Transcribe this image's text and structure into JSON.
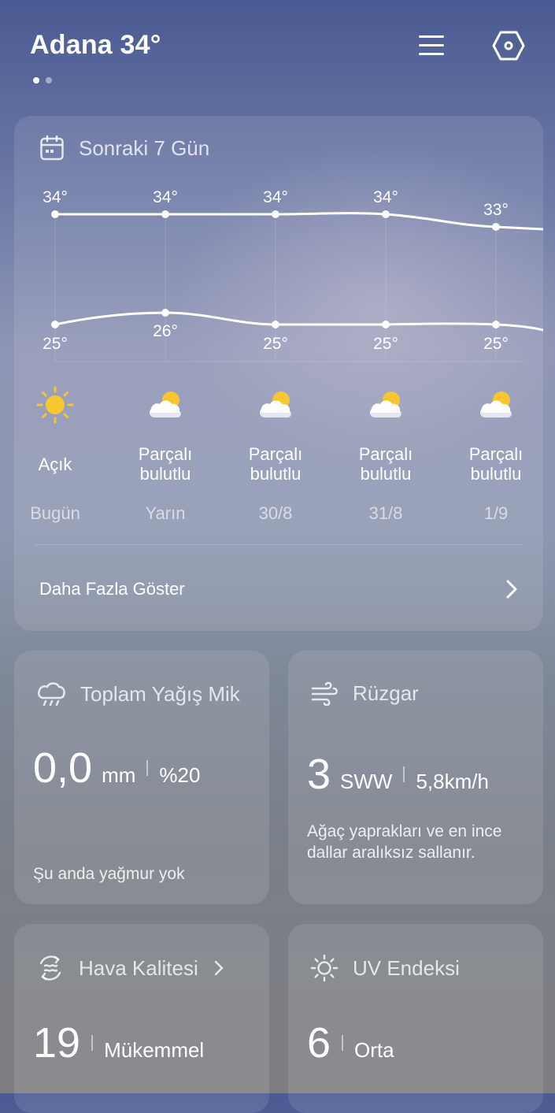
{
  "header": {
    "title": "Adana 34°"
  },
  "forecast": {
    "title": "Sonraki 7 Gün",
    "days": [
      {
        "high": "34°",
        "low": "25°",
        "condition": "Açık",
        "date": "Bugün",
        "icon": "sun-icon"
      },
      {
        "high": "34°",
        "low": "26°",
        "condition": "Parçalı bulutlu",
        "date": "Yarın",
        "icon": "partly-cloudy-icon"
      },
      {
        "high": "34°",
        "low": "25°",
        "condition": "Parçalı bulutlu",
        "date": "30/8",
        "icon": "partly-cloudy-icon"
      },
      {
        "high": "34°",
        "low": "25°",
        "condition": "Parçalı bulutlu",
        "date": "31/8",
        "icon": "partly-cloudy-icon"
      },
      {
        "high": "33°",
        "low": "25°",
        "condition": "Parçalı bulutlu",
        "date": "1/9",
        "icon": "partly-cloudy-icon"
      }
    ],
    "show_more": "Daha Fazla Göster"
  },
  "rain": {
    "title": "Toplam Yağış Mik",
    "value": "0,0",
    "unit": "mm",
    "chance": "%20",
    "description": "Şu anda yağmur yok"
  },
  "wind": {
    "title": "Rüzgar",
    "value": "3",
    "direction": "SWW",
    "speed": "5,8km/h",
    "description": "Ağaç yaprakları ve en ince dallar aralıksız sallanır."
  },
  "air_quality": {
    "title": "Hava Kalitesi",
    "value": "19",
    "label": "Mükemmel"
  },
  "uv": {
    "title": "UV Endeksi",
    "value": "6",
    "label": "Orta"
  },
  "colors": {
    "sun": "#f7c631",
    "card_bg": "rgba(255,255,255,0.10)"
  }
}
